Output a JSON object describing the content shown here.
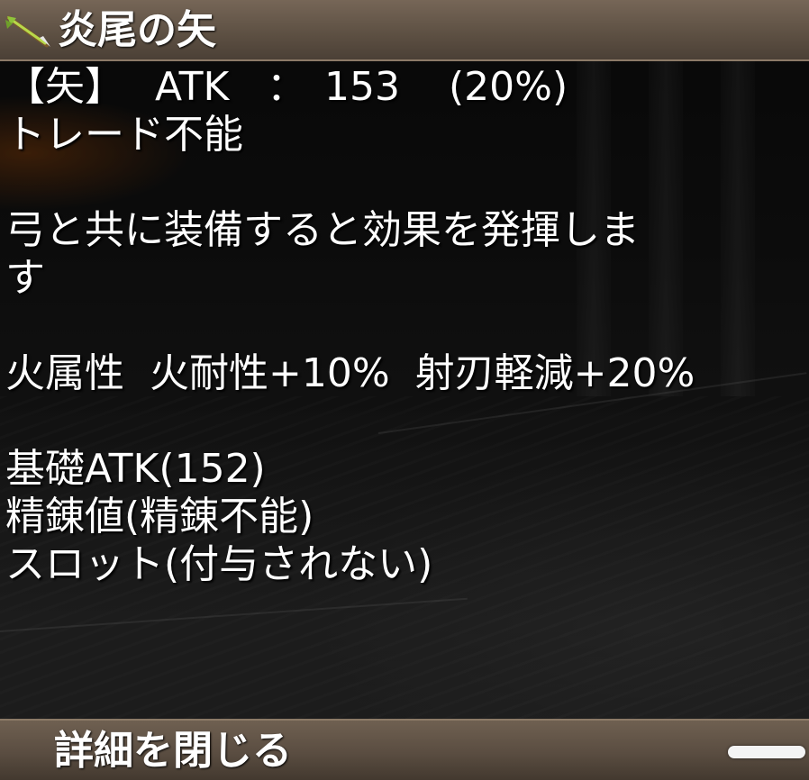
{
  "item": {
    "name": "炎尾の矢",
    "icon": "arrow-icon"
  },
  "stat": {
    "type": "【矢】",
    "name": "ATK",
    "colon": "：",
    "value": "153",
    "percent": "(20%)"
  },
  "lines": {
    "trade": "トレード不能",
    "effect_line1": "弓と共に装備すると効果を発揮しま",
    "effect_line2": "す",
    "attributes": "火属性  火耐性+10%  射刃軽減+20%",
    "base_atk": "基礎ATK(152)",
    "refine": "精錬値(精錬不能)",
    "slot": "スロット(付与されない)"
  },
  "footer": {
    "close_label": "詳細を閉じる"
  },
  "colors": {
    "title_bar": "#5c4f42",
    "text": "#ffffff",
    "handle": "#f4f4f4"
  }
}
